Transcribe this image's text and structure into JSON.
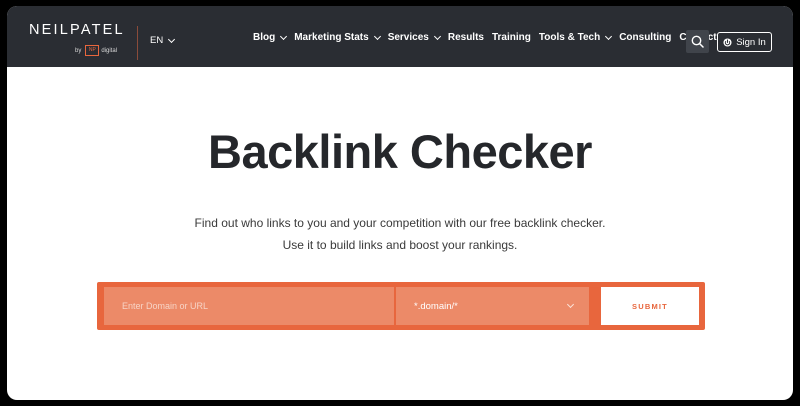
{
  "header": {
    "logo": {
      "wordmark": "NEILPATEL",
      "by": "by",
      "badge": "NP",
      "sub": "digital"
    },
    "language": "EN",
    "nav": [
      {
        "label": "Blog",
        "dropdown": true
      },
      {
        "label": "Marketing Stats",
        "dropdown": true
      },
      {
        "label": "Services",
        "dropdown": true
      },
      {
        "label": "Results",
        "dropdown": false
      },
      {
        "label": "Training",
        "dropdown": false
      },
      {
        "label": "Tools & Tech",
        "dropdown": true
      },
      {
        "label": "Consulting",
        "dropdown": false
      },
      {
        "label": "Contact",
        "dropdown": false
      }
    ],
    "search_icon": "search-icon",
    "signin_label": "Sign In",
    "signin_icon": "power-icon"
  },
  "hero": {
    "title": "Backlink Checker",
    "desc_line1": "Find out who links to you and your competition with our free backlink checker.",
    "desc_line2": "Use it to build links and boost your rankings."
  },
  "form": {
    "url_placeholder": "Enter Domain or URL",
    "scope_value": "*.domain/*",
    "submit_label": "SUBMIT"
  },
  "colors": {
    "topbar": "#2a2d33",
    "accent": "#e8663d",
    "field": "#ec8a68",
    "title": "#25272b"
  }
}
